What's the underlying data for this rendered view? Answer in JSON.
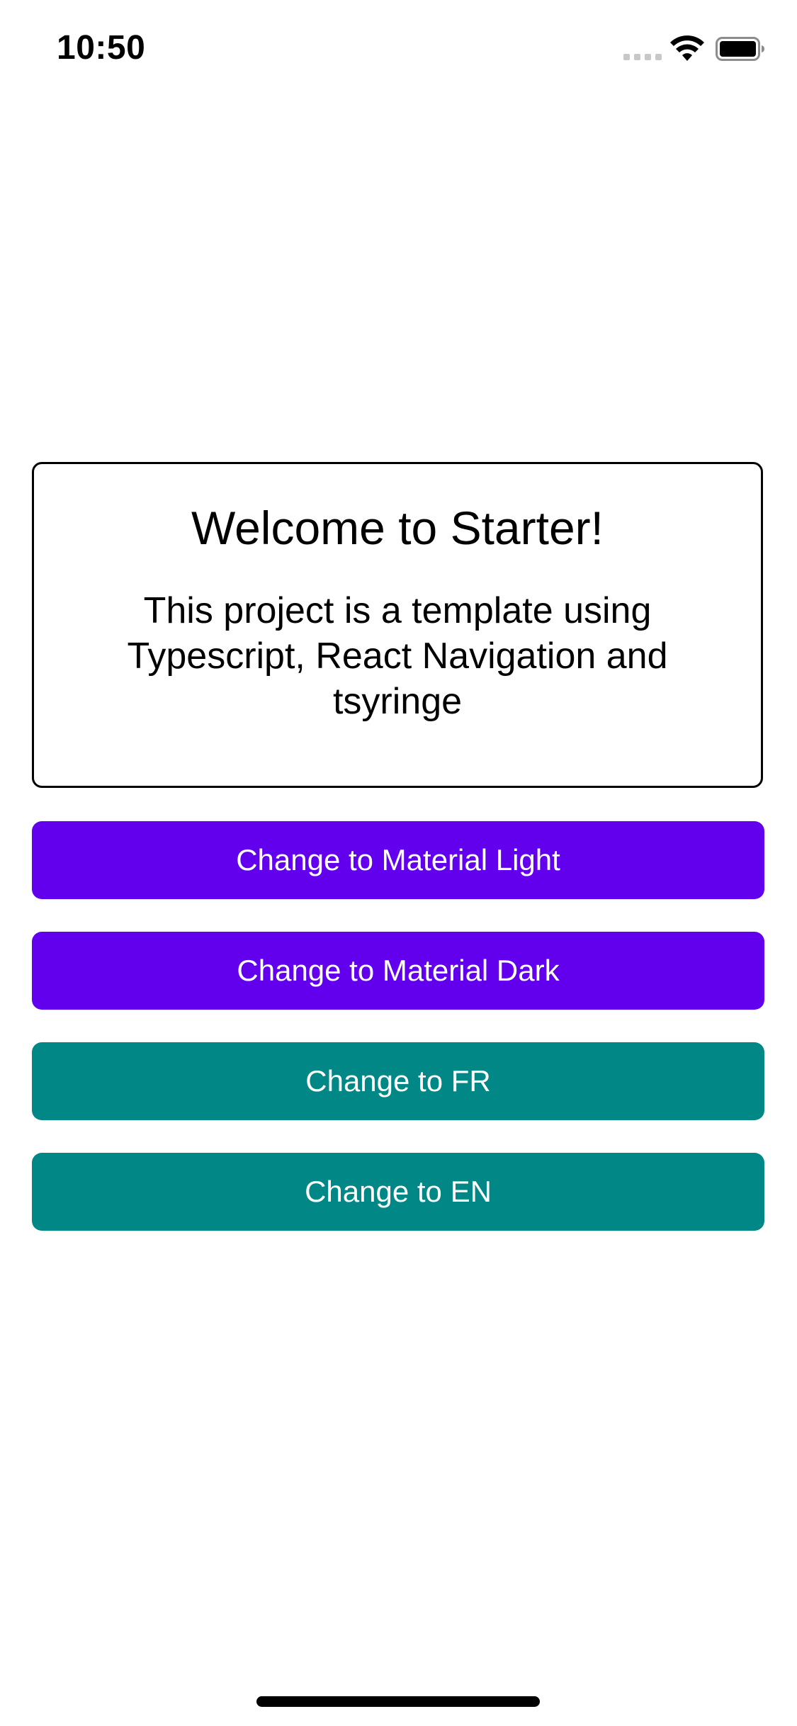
{
  "status_bar": {
    "time": "10:50",
    "icons": [
      "cellular-signal-icon",
      "wifi-icon",
      "battery-icon"
    ]
  },
  "welcome": {
    "title": "Welcome to Starter!",
    "description": "This project is a template using Typescript, React Navigation and tsyringe"
  },
  "buttons": [
    {
      "label": "Change to Material Light",
      "color": "#6200ee"
    },
    {
      "label": "Change to Material Dark",
      "color": "#6200ee"
    },
    {
      "label": "Change to FR",
      "color": "#018786"
    },
    {
      "label": "Change to EN",
      "color": "#018786"
    }
  ],
  "colors": {
    "primary": "#6200ee",
    "secondary": "#018786",
    "background": "#ffffff",
    "text": "#000000"
  }
}
